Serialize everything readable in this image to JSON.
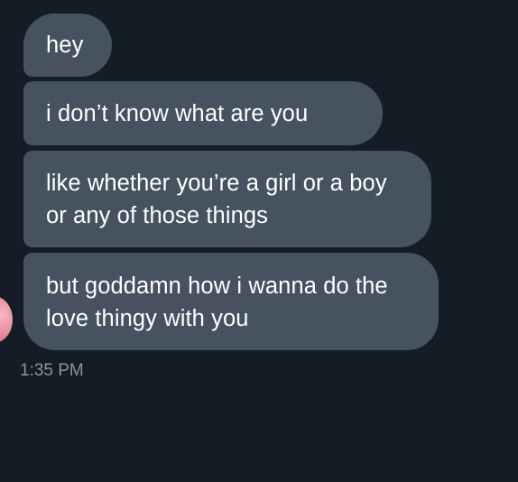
{
  "conversation": {
    "messages": [
      {
        "text": "hey"
      },
      {
        "text": "i don’t know what are you"
      },
      {
        "text": "like whether you’re a girl or a boy or any of those things"
      },
      {
        "text": "but goddamn how i wanna do the love thingy with you"
      }
    ],
    "timestamp": "1:35 PM"
  },
  "colors": {
    "background": "#161c25",
    "bubble": "#46525f",
    "text": "#ffffff",
    "timestamp": "#8a95a2"
  }
}
